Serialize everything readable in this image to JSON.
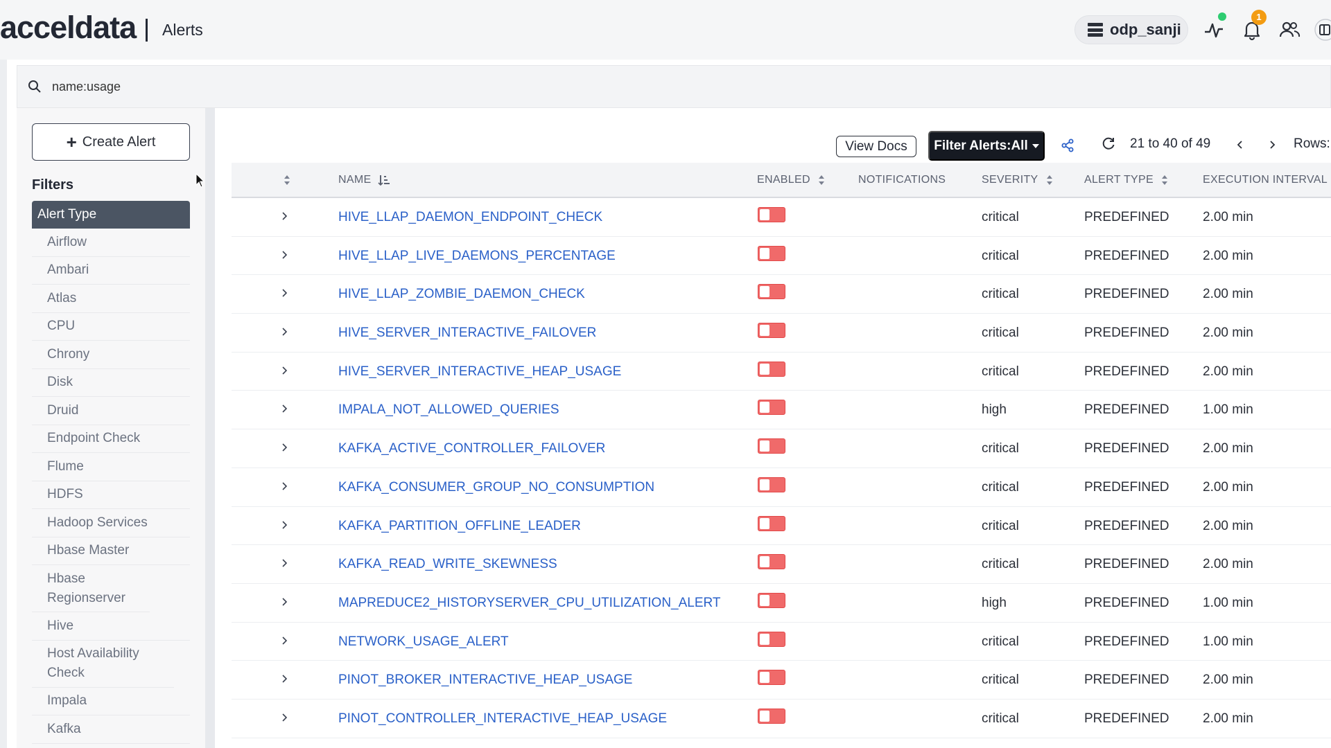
{
  "header": {
    "logo": "acceldata",
    "title": "Alerts",
    "cluster": "odp_sanji",
    "notification_count": "1",
    "icons": [
      "pulse-icon",
      "bell-icon",
      "users-icon",
      "panel-icon"
    ]
  },
  "search": {
    "value": "name:usage",
    "placeholder": ""
  },
  "sidebar": {
    "create_label": "Create Alert",
    "filters_title": "Filters",
    "group_label": "Alert Type",
    "items": [
      "Airflow",
      "Ambari",
      "Atlas",
      "CPU",
      "Chrony",
      "Disk",
      "Druid",
      "Endpoint Check",
      "Flume",
      "HDFS",
      "Hadoop Services",
      "Hbase Master",
      "Hbase Regionserver",
      "Hive",
      "Host Availability Check",
      "Impala",
      "Kafka"
    ]
  },
  "toolbar": {
    "view_docs": "View Docs",
    "filter_alerts": "Filter Alerts:All",
    "range": "21 to 40 of 49",
    "rows_label": "Rows:"
  },
  "table": {
    "columns": [
      "NAME",
      "ENABLED",
      "NOTIFICATIONS",
      "SEVERITY",
      "ALERT TYPE",
      "EXECUTION INTERVAL"
    ],
    "rows": [
      {
        "name": "HIVE_LLAP_DAEMON_ENDPOINT_CHECK",
        "severity": "critical",
        "alert_type": "PREDEFINED",
        "interval": "2.00 min"
      },
      {
        "name": "HIVE_LLAP_LIVE_DAEMONS_PERCENTAGE",
        "severity": "critical",
        "alert_type": "PREDEFINED",
        "interval": "2.00 min"
      },
      {
        "name": "HIVE_LLAP_ZOMBIE_DAEMON_CHECK",
        "severity": "critical",
        "alert_type": "PREDEFINED",
        "interval": "2.00 min"
      },
      {
        "name": "HIVE_SERVER_INTERACTIVE_FAILOVER",
        "severity": "critical",
        "alert_type": "PREDEFINED",
        "interval": "2.00 min"
      },
      {
        "name": "HIVE_SERVER_INTERACTIVE_HEAP_USAGE",
        "severity": "critical",
        "alert_type": "PREDEFINED",
        "interval": "2.00 min"
      },
      {
        "name": "IMPALA_NOT_ALLOWED_QUERIES",
        "severity": "high",
        "alert_type": "PREDEFINED",
        "interval": "1.00 min"
      },
      {
        "name": "KAFKA_ACTIVE_CONTROLLER_FAILOVER",
        "severity": "critical",
        "alert_type": "PREDEFINED",
        "interval": "2.00 min"
      },
      {
        "name": "KAFKA_CONSUMER_GROUP_NO_CONSUMPTION",
        "severity": "critical",
        "alert_type": "PREDEFINED",
        "interval": "2.00 min"
      },
      {
        "name": "KAFKA_PARTITION_OFFLINE_LEADER",
        "severity": "critical",
        "alert_type": "PREDEFINED",
        "interval": "2.00 min"
      },
      {
        "name": "KAFKA_READ_WRITE_SKEWNESS",
        "severity": "critical",
        "alert_type": "PREDEFINED",
        "interval": "2.00 min"
      },
      {
        "name": "MAPREDUCE2_HISTORYSERVER_CPU_UTILIZATION_ALERT",
        "severity": "high",
        "alert_type": "PREDEFINED",
        "interval": "1.00 min"
      },
      {
        "name": "NETWORK_USAGE_ALERT",
        "severity": "critical",
        "alert_type": "PREDEFINED",
        "interval": "1.00 min"
      },
      {
        "name": "PINOT_BROKER_INTERACTIVE_HEAP_USAGE",
        "severity": "critical",
        "alert_type": "PREDEFINED",
        "interval": "2.00 min"
      },
      {
        "name": "PINOT_CONTROLLER_INTERACTIVE_HEAP_USAGE",
        "severity": "critical",
        "alert_type": "PREDEFINED",
        "interval": "2.00 min"
      }
    ]
  },
  "colors": {
    "link": "#2a60c8",
    "toggle_off": "#f06a6a",
    "filter_button": "#161a22",
    "group_header": "#4b5563"
  }
}
